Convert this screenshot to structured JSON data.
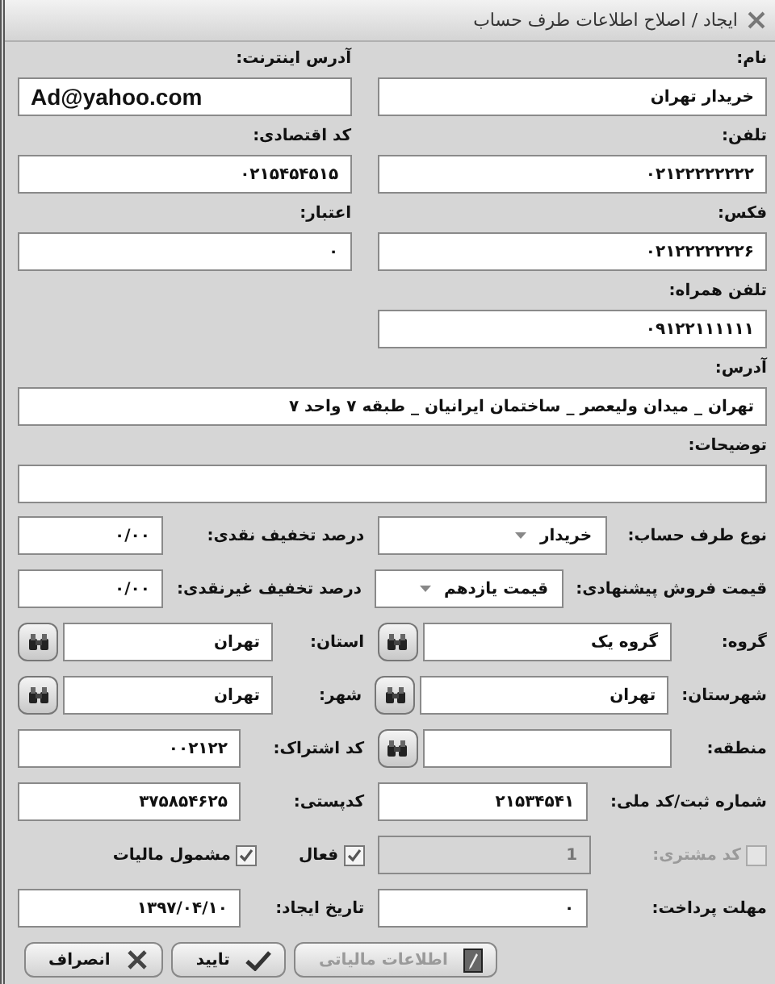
{
  "window": {
    "title": "ایجاد / اصلاح اطلاعات طرف حساب"
  },
  "top_section": {
    "right": [
      {
        "label": "نام:",
        "value": "خریدار تهران"
      },
      {
        "label": "تلفن:",
        "value": "۰۲۱۲۲۲۲۲۲۲۲"
      },
      {
        "label": "فکس:",
        "value": "۰۲۱۲۲۲۲۲۲۲۶"
      },
      {
        "label": "تلفن همراه:",
        "value": "۰۹۱۲۲۱۱۱۱۱۱"
      }
    ],
    "left": [
      {
        "label": "آدرس اینترنت:",
        "value": "Ad@yahoo.com",
        "latin": true
      },
      {
        "label": "کد اقتصادی:",
        "value": "۰۲۱۵۴۵۴۵۱۵"
      },
      {
        "label": "اعتبار:",
        "value": "۰"
      }
    ]
  },
  "address": {
    "label": "آدرس:",
    "value": "تهران _ میدان ولیعصر _ ساختمان ایرانیان _ طبقه ۷ واحد ۷"
  },
  "description": {
    "label": "توضیحات:"
  },
  "rows": [
    {
      "right": {
        "kind": "select",
        "label": "نوع طرف حساب:",
        "value": "خریدار"
      },
      "left": {
        "kind": "text",
        "label": "درصد تخفیف نقدی:",
        "value": "۰/۰۰"
      }
    },
    {
      "right": {
        "kind": "select",
        "label": "قیمت فروش پیشنهادی:",
        "value": "قیمت یازدهم"
      },
      "left": {
        "kind": "text",
        "label": "درصد تخفیف غیرنقدی:",
        "value": "۰/۰۰"
      }
    },
    {
      "right": {
        "kind": "lookup",
        "label": "گروه:",
        "value": "گروه یک"
      },
      "left": {
        "kind": "lookup",
        "label": "استان:",
        "value": "تهران"
      }
    },
    {
      "right": {
        "kind": "lookup",
        "label": "شهرستان:",
        "value": "تهران"
      },
      "left": {
        "kind": "lookup",
        "label": "شهر:",
        "value": "تهران"
      }
    },
    {
      "right": {
        "kind": "lookup",
        "label": "منطقه:"
      },
      "left": {
        "kind": "text",
        "label": "کد اشتراک:",
        "value": "۰۰۲۱۲۲"
      }
    },
    {
      "right": {
        "kind": "text",
        "label": "شماره ثبت/کد ملی:",
        "value": "۲۱۵۳۴۵۴۱"
      },
      "left": {
        "kind": "text",
        "label": "کدپستی:",
        "value": "۳۷۵۸۵۴۶۲۵"
      }
    },
    {
      "right": {
        "kind": "check_text",
        "label": "کد مشتری:",
        "checked": false,
        "disabled": true,
        "value": "1"
      },
      "left": {
        "kind": "checks",
        "items": [
          {
            "label": "فعال",
            "checked": true
          },
          {
            "label": "مشمول مالیات",
            "checked": true
          }
        ]
      }
    },
    {
      "right": {
        "kind": "text",
        "label": "مهلت پرداخت:",
        "value": "۰"
      },
      "left": {
        "kind": "text",
        "label": "تاریخ ایجاد:",
        "value": "۱۳۹۷/۰۴/۱۰"
      }
    }
  ],
  "buttons": [
    {
      "kind": "edit",
      "label": "اطلاعات مالیاتی",
      "disabled": true
    },
    {
      "kind": "confirm",
      "label": "تایید",
      "disabled": false
    },
    {
      "kind": "cancel",
      "label": "انصراف",
      "disabled": false
    }
  ]
}
